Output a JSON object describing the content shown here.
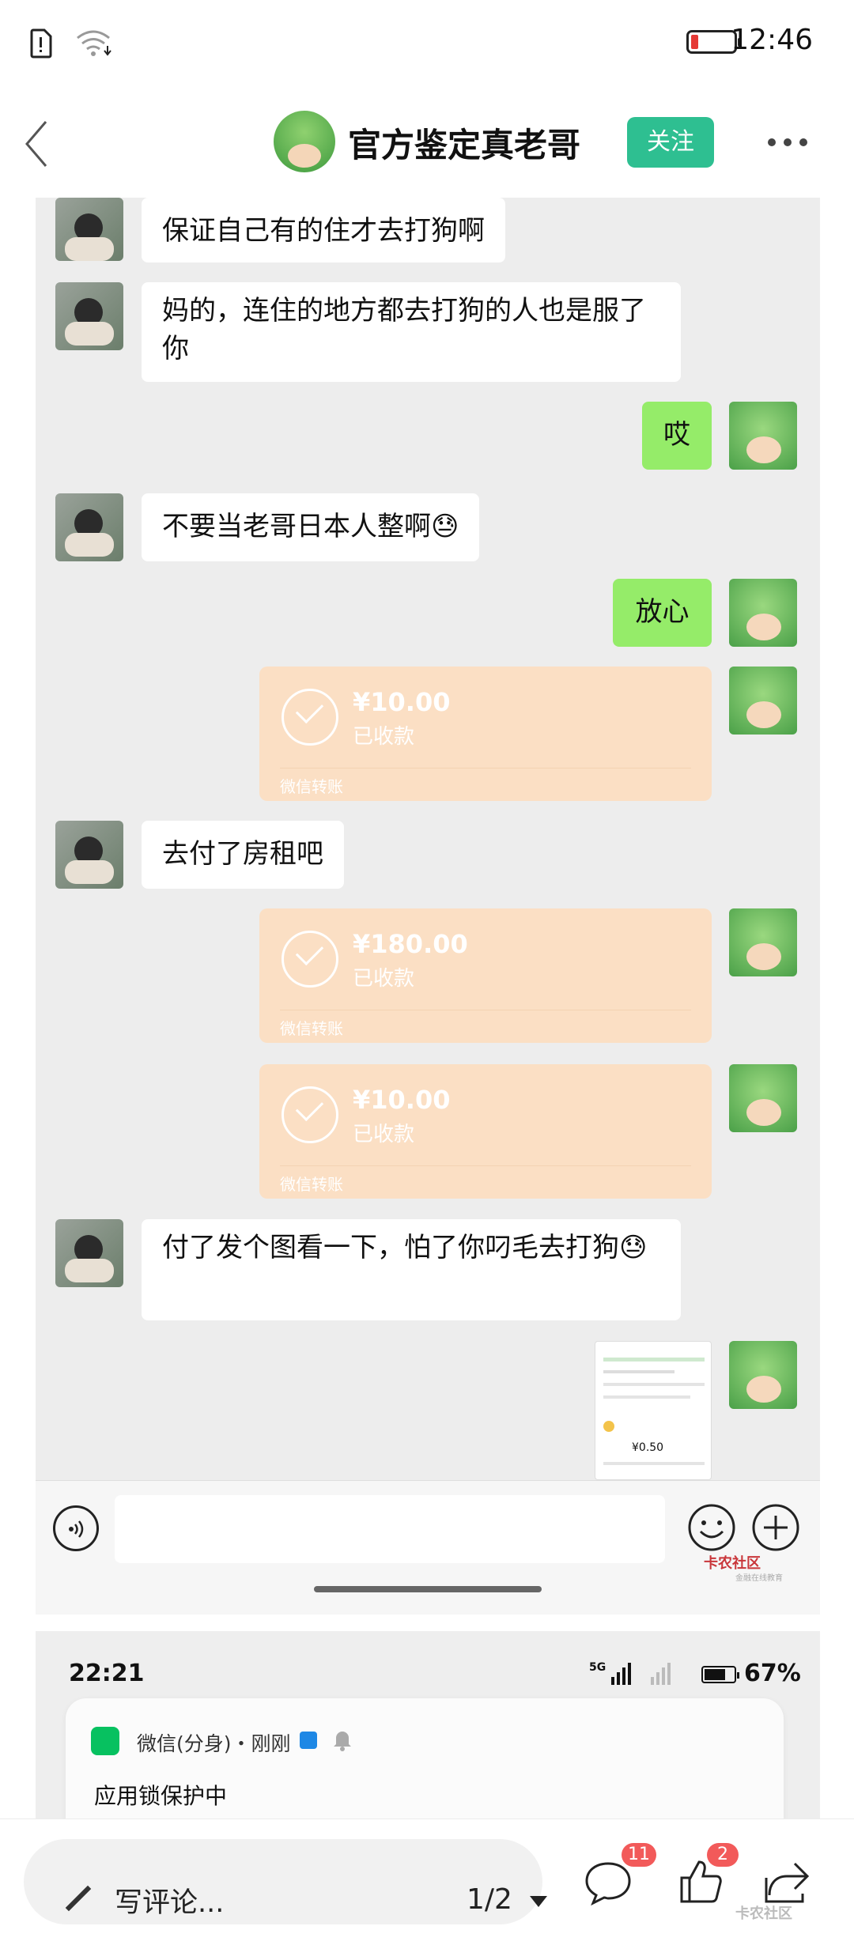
{
  "status_bar": {
    "time": "12:46"
  },
  "header": {
    "title": "官方鉴定真老哥",
    "follow_label": "关注"
  },
  "chat": {
    "messages": [
      {
        "side": "left",
        "text": "保证自己有的住才去打狗啊"
      },
      {
        "side": "left",
        "text": "妈的，连住的地方都去打狗的人也是服了你"
      },
      {
        "side": "right",
        "text": "哎"
      },
      {
        "side": "left",
        "text": "不要当老哥日本人整啊😓"
      },
      {
        "side": "right",
        "text": "放心"
      },
      {
        "side": "right",
        "type": "transfer",
        "amount": "¥10.00",
        "status": "已收款",
        "footer": "微信转账"
      },
      {
        "side": "left",
        "text": "去付了房租吧"
      },
      {
        "side": "right",
        "type": "transfer",
        "amount": "¥180.00",
        "status": "已收款",
        "footer": "微信转账"
      },
      {
        "side": "right",
        "type": "transfer",
        "amount": "¥10.00",
        "status": "已收款",
        "footer": "微信转账"
      },
      {
        "side": "left",
        "text": "付了发个图看一下，怕了你叼毛去打狗😓"
      },
      {
        "side": "right",
        "type": "image",
        "thumb_amount": "¥0.50"
      }
    ]
  },
  "watermark": {
    "brand": "卡农社区",
    "tagline": "金融在线教育"
  },
  "screenshot2": {
    "time": "22:21",
    "network": "5G",
    "battery": "67%",
    "notification": {
      "source": "微信(分身)・刚刚",
      "body": "应用锁保护中"
    }
  },
  "bottom_bar": {
    "comment_placeholder": "写评论...",
    "page": "1/2",
    "comment_count": "11",
    "like_count": "2"
  }
}
